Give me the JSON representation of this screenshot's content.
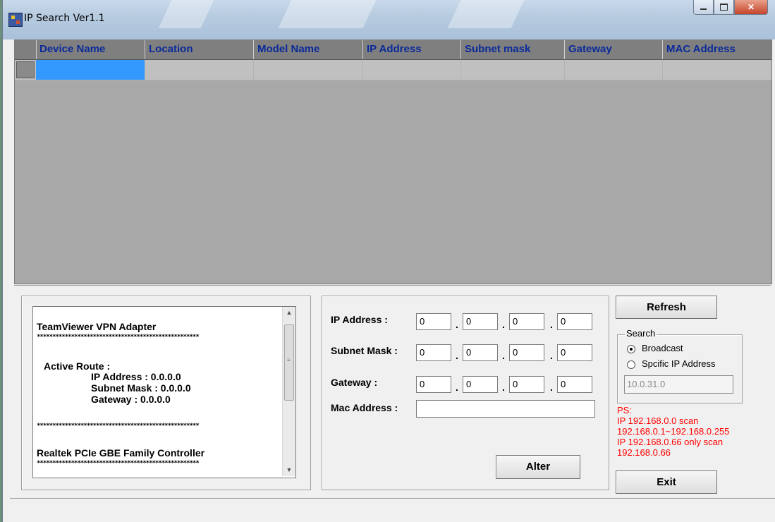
{
  "window": {
    "title": "IP Search Ver1.1"
  },
  "grid": {
    "columns": [
      "Device Name",
      "Location",
      "Model Name",
      "IP Address",
      "Subnet mask",
      "Gateway",
      "MAC Address"
    ]
  },
  "adapters": {
    "adapter1_name": "TeamViewer VPN Adapter",
    "stars": "****************************************************",
    "active_route_label": "Active Route :",
    "ip_line": "IP Address : 0.0.0.0",
    "subnet_line": "Subnet Mask : 0.0.0.0",
    "gateway_line": "Gateway : 0.0.0.0",
    "adapter2_name": "Realtek PCIe GBE Family Controller"
  },
  "form": {
    "ip_label": "IP Address :",
    "subnet_label": "Subnet Mask :",
    "gateway_label": "Gateway :",
    "mac_label": "Mac Address :",
    "ip": [
      "0",
      "0",
      "0",
      "0"
    ],
    "subnet": [
      "0",
      "0",
      "0",
      "0"
    ],
    "gateway": [
      "0",
      "0",
      "0",
      "0"
    ],
    "mac": "",
    "alter_label": "Alter"
  },
  "controls": {
    "refresh_label": "Refresh",
    "search_legend": "Search",
    "broadcast_label": "Broadcast",
    "specific_label": "Spcific IP Address",
    "selected": "Broadcast",
    "specific_ip": "10.0.31.0",
    "exit_label": "Exit"
  },
  "ps_note": {
    "line1": "PS:",
    "line2": "IP 192.168.0.0 scan",
    "line3": "192.168.0.1~192.168.0.255",
    "line4": "IP 192.168.0.66 only scan",
    "line5": "192.168.0.66"
  },
  "colors": {
    "header_text": "#0a2a9a",
    "selected_cell": "#3399ff",
    "ps_text": "#ff0000"
  }
}
